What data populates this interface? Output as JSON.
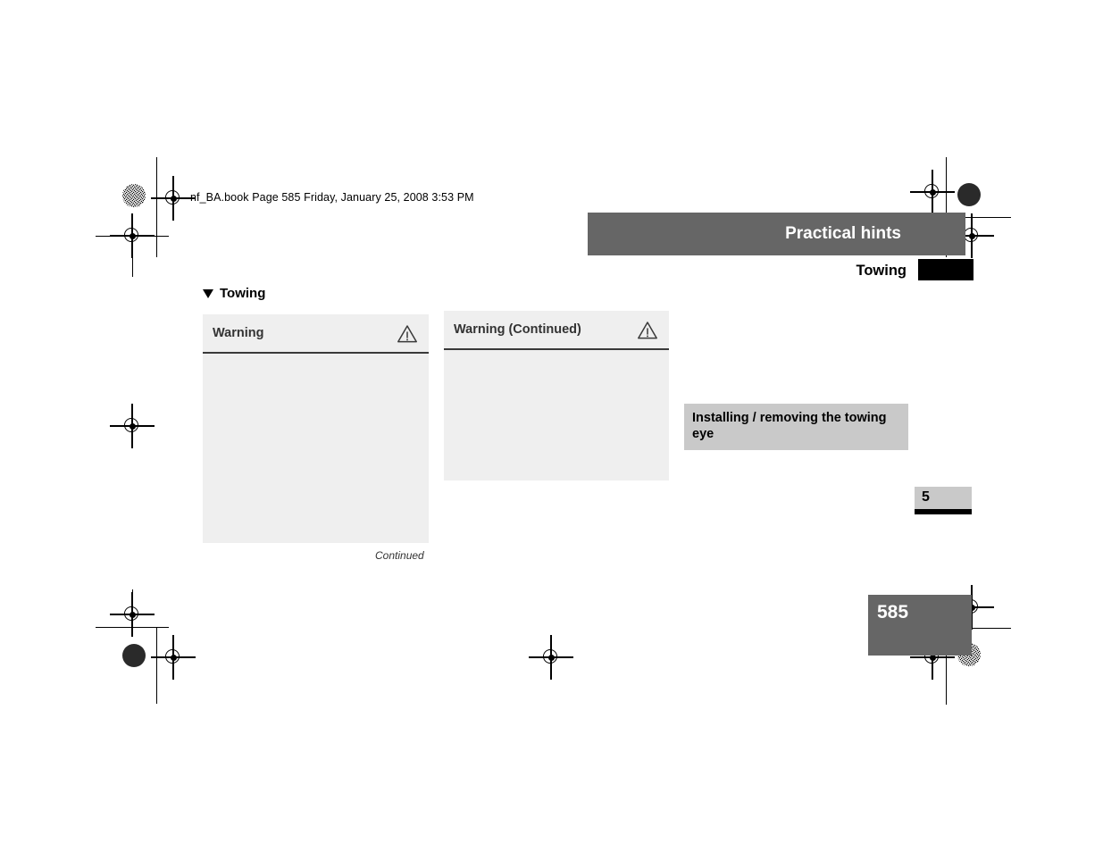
{
  "page": {
    "file_info": "nf_BA.book  Page 585  Friday, January 25, 2008  3:53 PM",
    "page_number": "585",
    "chapter_number": "5",
    "background_color": "#ffffff"
  },
  "header": {
    "title": "Practical hints",
    "subtitle": "Towing",
    "bar_color": "#666666",
    "title_color": "#ffffff"
  },
  "section": {
    "heading": "Towing",
    "marker_icon": "triangle-down-icon"
  },
  "warnings": [
    {
      "title": "Warning",
      "icon": "warning-triangle-icon",
      "body": "",
      "background_color": "#efefef"
    },
    {
      "title": "Warning (Continued)",
      "icon": "warning-triangle-icon",
      "body": "",
      "background_color": "#efefef"
    }
  ],
  "continued_note": "Continued",
  "subheading": {
    "text": "Installing / removing the towing eye",
    "background_color": "#c9c9c9"
  },
  "marks": {
    "registration_icon": "registration-target-icon",
    "halftone_icon": "halftone-dot-icon"
  }
}
